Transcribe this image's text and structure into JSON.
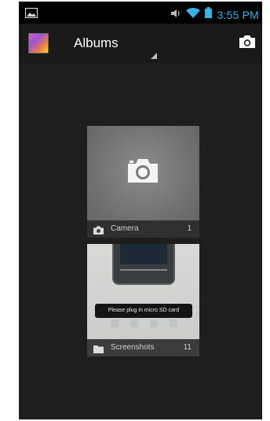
{
  "colors": {
    "accent": "#33b5e5",
    "background": "#1e1e1e",
    "statusbar": "#000000"
  },
  "statusbar": {
    "time": "3:55 PM",
    "icons": [
      "picture-icon",
      "volume-icon",
      "wifi-icon",
      "battery-icon"
    ]
  },
  "actionbar": {
    "title": "Albums",
    "app_icon": "gallery-app-icon",
    "camera_icon": "camera-icon"
  },
  "albums": [
    {
      "name": "Camera",
      "count": "1",
      "icon": "camera-icon"
    },
    {
      "name": "Screenshots",
      "count": "11",
      "icon": "folder-icon",
      "toast": "Please plug in micro SD card"
    }
  ]
}
